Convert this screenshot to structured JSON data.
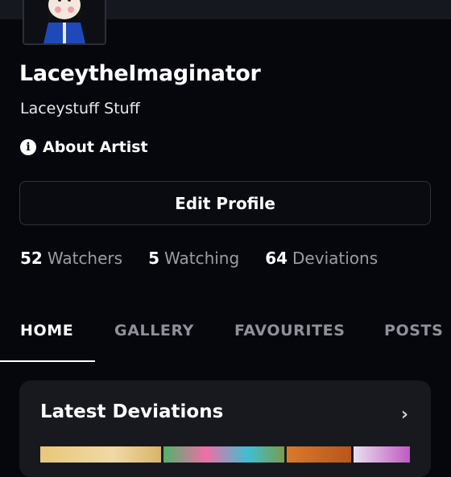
{
  "profile": {
    "username": "LaceytheImaginator",
    "tagline": "Laceystuff Stuff",
    "about_label": "About Artist"
  },
  "actions": {
    "edit_profile_label": "Edit Profile"
  },
  "stats": [
    {
      "number": "52",
      "label": "Watchers"
    },
    {
      "number": "5",
      "label": "Watching"
    },
    {
      "number": "64",
      "label": "Deviations"
    }
  ],
  "tabs": [
    {
      "label": "HOME",
      "active": true
    },
    {
      "label": "GALLERY",
      "active": false
    },
    {
      "label": "FAVOURITES",
      "active": false
    },
    {
      "label": "POSTS",
      "active": false
    }
  ],
  "latest": {
    "title": "Latest Deviations"
  },
  "icons": {
    "info": "info-icon",
    "chevron": "chevron-right-icon"
  },
  "colors": {
    "background": "#06070d",
    "card": "#17191f",
    "muted_text": "#9a9da6"
  }
}
